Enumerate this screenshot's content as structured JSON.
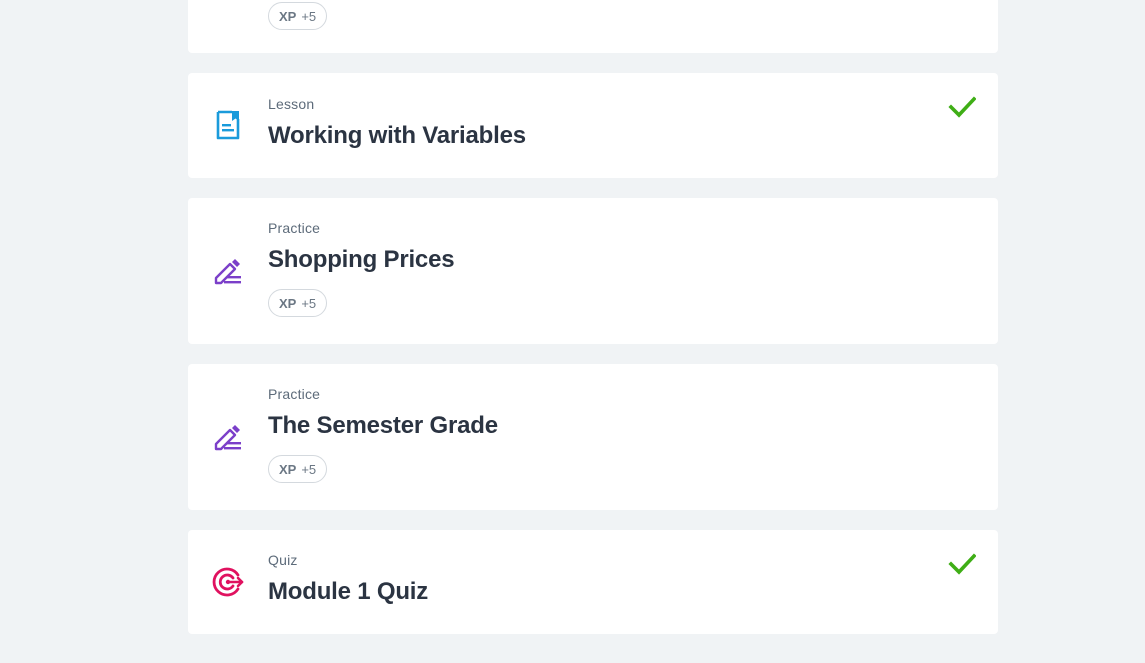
{
  "cards": [
    {
      "type": "",
      "title": "",
      "xp_key": "XP",
      "xp_value": "+5",
      "icon": "none",
      "completed": false
    },
    {
      "type": "Lesson",
      "title": "Working with Variables",
      "icon": "lesson-document-icon",
      "completed": true
    },
    {
      "type": "Practice",
      "title": "Shopping Prices",
      "xp_key": "XP",
      "xp_value": "+5",
      "icon": "pencil-edit-icon",
      "completed": false
    },
    {
      "type": "Practice",
      "title": "The Semester Grade",
      "xp_key": "XP",
      "xp_value": "+5",
      "icon": "pencil-edit-icon",
      "completed": false
    },
    {
      "type": "Quiz",
      "title": "Module 1 Quiz",
      "icon": "target-icon",
      "completed": true
    }
  ],
  "colors": {
    "background": "#f0f3f5",
    "lesson_icon": "#1a9bdb",
    "practice_icon": "#7b3fc9",
    "quiz_icon": "#e0115f",
    "check": "#3fae16",
    "title": "#2b3442",
    "type_label": "#5d6b7a"
  }
}
